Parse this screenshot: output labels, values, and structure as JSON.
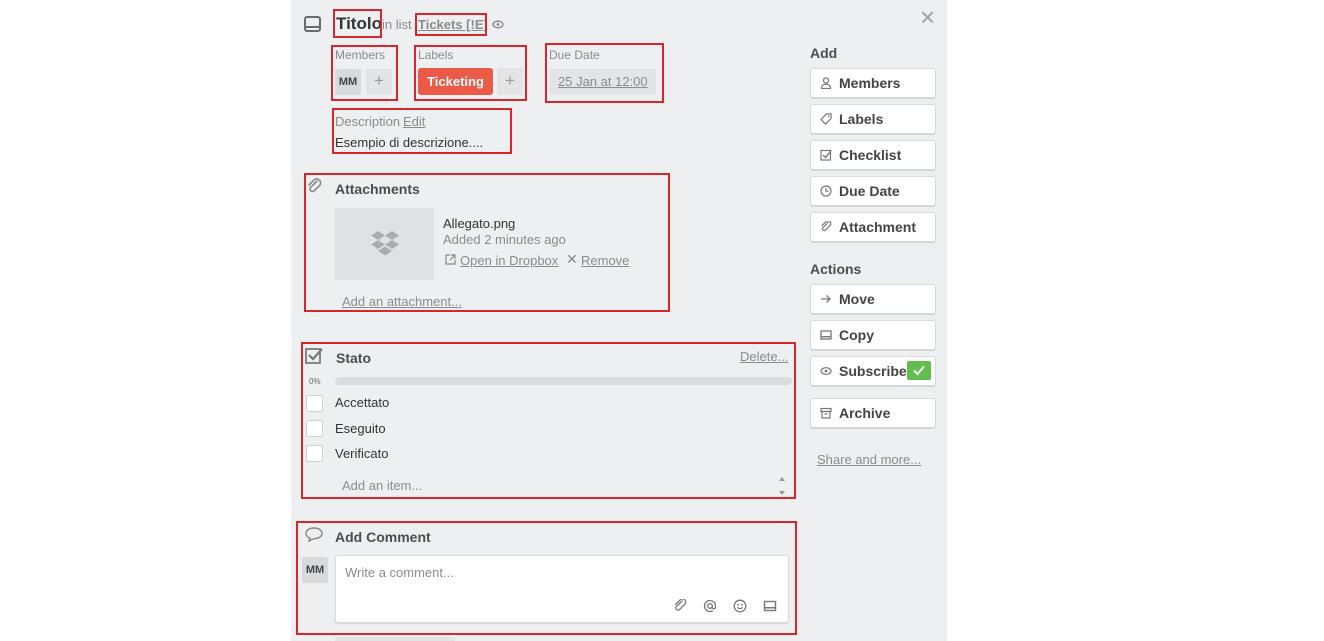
{
  "card": {
    "title": "Titolo",
    "in_list_prefix": "in list",
    "list_name": "Tickets [!E]"
  },
  "members": {
    "heading": "Members",
    "avatar_initials": "MM",
    "add_symbol": "+"
  },
  "labels": {
    "heading": "Labels",
    "label_text": "Ticketing",
    "label_color": "#eb5a46",
    "add_symbol": "+"
  },
  "due": {
    "heading": "Due Date",
    "value": "25 Jan at 12:00"
  },
  "description": {
    "heading": "Description",
    "edit_link": "Edit",
    "text": "Esempio di descrizione...."
  },
  "attachments": {
    "heading": "Attachments",
    "file_name": "Allegato.png",
    "added": "Added 2 minutes ago",
    "open_link": "Open in Dropbox",
    "remove_link": "Remove",
    "add_link": "Add an attachment..."
  },
  "checklist": {
    "title": "Stato",
    "delete_link": "Delete...",
    "progress_label": "0%",
    "progress": 0,
    "items": [
      "Accettato",
      "Eseguito",
      "Verificato"
    ],
    "add_placeholder": "Add an item..."
  },
  "comment": {
    "heading": "Add Comment",
    "avatar_initials": "MM",
    "placeholder": "Write a comment..."
  },
  "sidebar": {
    "add_heading": "Add",
    "add_buttons": [
      "Members",
      "Labels",
      "Checklist",
      "Due Date",
      "Attachment"
    ],
    "actions_heading": "Actions",
    "action_buttons": [
      "Move",
      "Copy",
      "Subscribe",
      "Archive"
    ],
    "subscribed": true,
    "share_link": "Share and more..."
  },
  "close_symbol": "×",
  "colors": {
    "highlight": "#d6272e",
    "subscribe_check": "#61bd4f",
    "panel_bg": "#edeff0"
  }
}
